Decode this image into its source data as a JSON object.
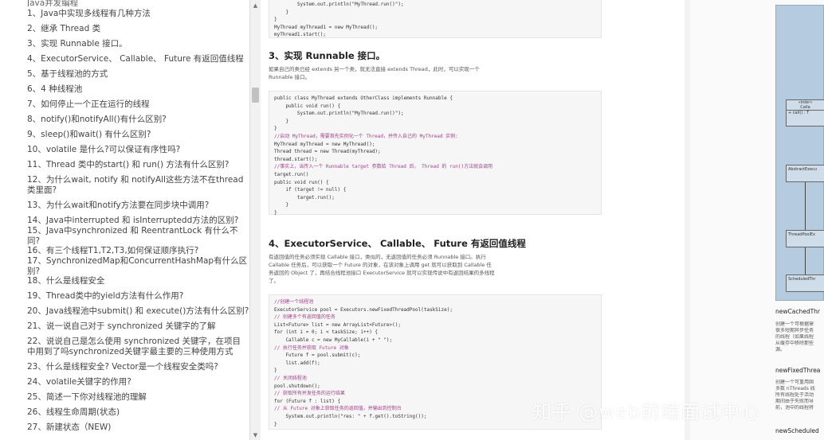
{
  "toc": {
    "header": "Java并发编程",
    "items": [
      "1、Java中实现多线程有几种方法",
      "2、继承 Thread 类",
      "3、实现 Runnable 接口。",
      "4、ExecutorService、 Callable、 Future 有返回值线程",
      "5、基于线程池的方式",
      "6、4 种线程池",
      "7、如何停止一个正在运行的线程",
      "8、notify()和notifyAll()有什么区别?",
      "9、sleep()和wait() 有什么区别?",
      "10、volatile 是什么?可以保证有序性吗?",
      "11、Thread 类中的start() 和 run() 方法有什么区别?",
      "12、为什么wait, notify 和 notifyAll这些方法不在thread类里面?",
      "13、为什么wait和notify方法要在同步块中调用?",
      "14、Java中interrupted 和 isInterruptedd方法的区别?",
      "15、Java中synchronized 和 ReentrantLock 有什么不同?",
      "16、有三个线程T1,T2,T3,如何保证顺序执行?",
      "17、SynchronizedMap和ConcurrentHashMap有什么区别?",
      "18、什么是线程安全",
      "19、Thread类中的yield方法有什么作用?",
      "20、Java线程池中submit() 和 execute()方法有什么区别?",
      "21、说一说自己对于 synchronized 关键字的了解",
      "22、说说自己是怎么使用 synchronized 关键字，在项目中用到了吗synchronized关键字最主要的三种使用方式",
      "23、什么是线程安全? Vector是一个线程安全类吗?",
      "24、volatile关键字的作用?",
      "25、简述一下你对线程池的理解",
      "26、线程生命周期(状态)",
      "27、新建状态（NEW)"
    ]
  },
  "scrollbar": {
    "up": "▲",
    "down": "▼"
  },
  "article": {
    "code1": [
      "        System.out.println(\"MyThread.run()\");",
      "    }",
      "}",
      "MyThread myThread1 = new MyThread();",
      "myThread1.start();"
    ],
    "h3": "3、实现 Runnable 接口。",
    "p3": "如果自己的类已经 extends 另一个类，就无法直接 extends Thread，此时，可以实现一个 Runnable 接口。",
    "code2": [
      {
        "t": "public class MyThread extends OtherClass implements Runnable {",
        "c": false
      },
      {
        "t": "    public void run() {",
        "c": false
      },
      {
        "t": "        System.out.println(\"MyThread.run()\");",
        "c": false
      },
      {
        "t": "    }",
        "c": false
      },
      {
        "t": "}",
        "c": false
      },
      {
        "t": "//启动 MyThread，需要首先实例化一个 Thread，并传入自己的 MyThread 实例:",
        "c": true
      },
      {
        "t": "MyThread myThread = new MyThread();",
        "c": false
      },
      {
        "t": "Thread thread = new Thread(myThread);",
        "c": false
      },
      {
        "t": "thread.start();",
        "c": false
      },
      {
        "t": "//事实上，当传入一个 Runnable target 参数给 Thread 后， Thread 的 run()方法就会调用",
        "c": true
      },
      {
        "t": "target.run()",
        "c": false
      },
      {
        "t": "public void run() {",
        "c": false
      },
      {
        "t": "    if (target != null) {",
        "c": false
      },
      {
        "t": "        target.run();",
        "c": false
      },
      {
        "t": "    }",
        "c": false
      },
      {
        "t": "}",
        "c": false
      }
    ],
    "h4": "4、ExecutorService、 Callable、 Future 有返回值线程",
    "p4": "有返回值的任务必须实现 Callable 接口，类似的，无返回值的任务必须 Runnable 接口。执行 Callable 任务后，可以获取一个 Future 的对象，在该对象上调用 get 就可以获取到 Callable 任务返回的 Object 了，再结合线程池接口 ExecutorService 就可以实现传说中有返回结果的多线程了。",
    "code3": [
      {
        "t": "//创建一个线程池",
        "c": true
      },
      {
        "t": "ExecutorService pool = Executors.newFixedThreadPool(taskSize);",
        "c": false
      },
      {
        "t": "// 创建多个有返回值的任务",
        "c": true
      },
      {
        "t": "List<Future> list = new ArrayList<Future>();",
        "c": false
      },
      {
        "t": "for (int i = 0; i < taskSize; i++) {",
        "c": false
      },
      {
        "t": "    Callable c = new MyCallable(i + \" \");",
        "c": false
      },
      {
        "t": "// 执行任务并获取 Future 对象",
        "c": true
      },
      {
        "t": "    Future f = pool.submit(c);",
        "c": false
      },
      {
        "t": "    list.add(f);",
        "c": false
      },
      {
        "t": "}",
        "c": false
      },
      {
        "t": "// 关闭线程池",
        "c": true
      },
      {
        "t": "pool.shutdown();",
        "c": false
      },
      {
        "t": "// 获取所有并发任务的运行结果",
        "c": true
      },
      {
        "t": "for (Future f : list) {",
        "c": false
      },
      {
        "t": "// 从 Future 对象上获取任务的返回值，并输出到控制台",
        "c": true
      },
      {
        "t": "    System.out.println(\"res: \" + f.get().toString());",
        "c": false
      },
      {
        "t": "}",
        "c": false
      }
    ]
  },
  "right_pane": {
    "diagram": {
      "box1_title": "«inter»",
      "box1_name": "Calla",
      "box1_method": "+ call() : T",
      "box2": "AbstractExecu",
      "box3": "ThreadPoolEx",
      "box4": "ScheduledThr"
    },
    "label1": "newCachedThr",
    "text1": [
      "创建一个可根据需",
      "很多短期异步任务",
      "的线程（如果线程",
      "从缓存中移除那些",
      "源。"
    ],
    "label2": "newFixedThrea",
    "text2": [
      "创建一个可重用固",
      "多数 nThreads 线",
      "所有线程处于活动",
      "期间由于失败而导",
      "前，池中的线程将"
    ],
    "label3": "newScheduled"
  },
  "watermark": "知乎 @web前端面试中心"
}
